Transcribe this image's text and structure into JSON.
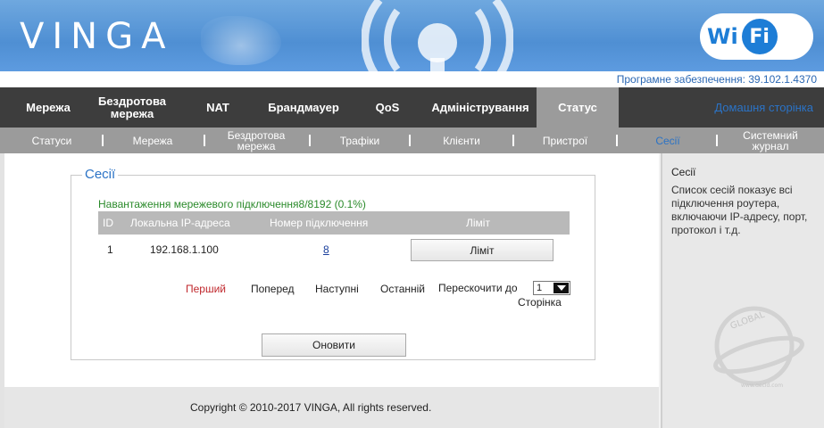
{
  "header": {
    "logo": "VINGA",
    "badge_left": "Wi",
    "badge_right": "Fi",
    "firmware": "Програмне забезпечення: 39.102.1.4370"
  },
  "main_nav": {
    "items": [
      {
        "label": "Мережа"
      },
      {
        "label": "Бездротова мережа"
      },
      {
        "label": "NAT"
      },
      {
        "label": "Брандмауер"
      },
      {
        "label": "QoS"
      },
      {
        "label": "Адміністрування"
      },
      {
        "label": "Статус",
        "active": true
      }
    ],
    "home": "Домашня сторінка"
  },
  "sub_nav": {
    "items": [
      {
        "label": "Статуси"
      },
      {
        "label": "Мережа"
      },
      {
        "label": "Бездротова мережа"
      },
      {
        "label": "Трафіки"
      },
      {
        "label": "Клієнти"
      },
      {
        "label": "Пристрої"
      },
      {
        "label": "Сесії",
        "active": true
      },
      {
        "label": "Системний журнал"
      }
    ]
  },
  "sessions": {
    "legend": "Сесії",
    "load_text": "Навантаження мережевого підключення8/8192 (0.1%)",
    "columns": [
      "ID",
      "Локальна IP-адреса",
      "Номер підключення",
      "Ліміт"
    ],
    "rows": [
      {
        "id": "1",
        "ip": "192.168.1.100",
        "conn": "8",
        "button": "Ліміт"
      }
    ],
    "pager": {
      "first": "Перший",
      "prev": "Поперед",
      "next": "Наступні",
      "last": "Останній",
      "jump": "Перескочити до",
      "page_word": "Сторінка",
      "selected_page": "1"
    },
    "refresh": "Оновити"
  },
  "sidebar": {
    "title": "Сесії",
    "text": "Список сесій показує всі підключення роутера, включаючи IP-адресу, порт, протокол і т.д."
  },
  "watermark": {
    "top": "GLOBAL",
    "url": "www.gecid.com"
  },
  "footer": {
    "copyright": "Copyright © 2010-2017 VINGA, All rights reserved."
  }
}
